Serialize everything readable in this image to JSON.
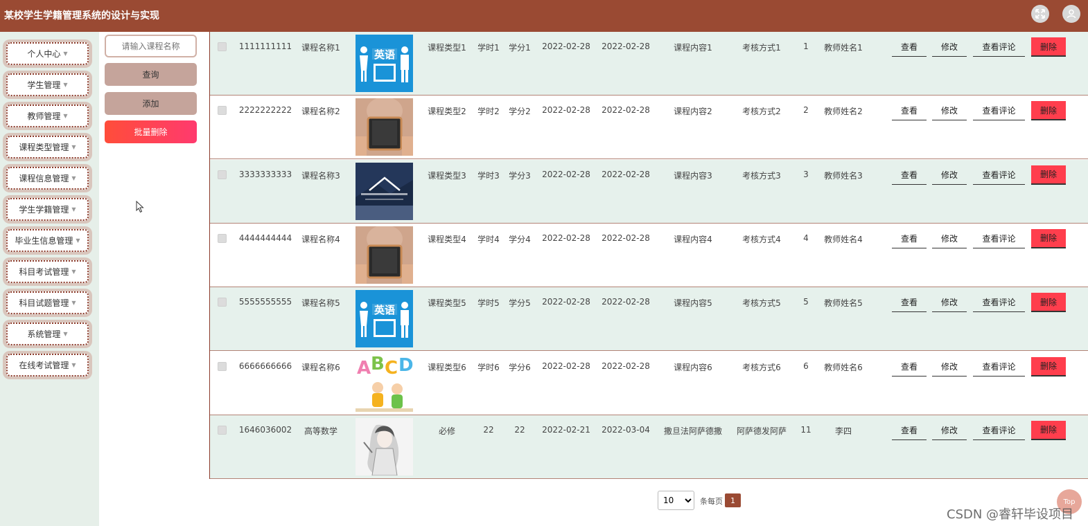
{
  "app": {
    "title": "某校学生学籍管理系统的设计与实现"
  },
  "header_icons": [
    "fullscreen-icon",
    "user-icon"
  ],
  "sidebar": {
    "items": [
      {
        "label": "个人中心"
      },
      {
        "label": "学生管理"
      },
      {
        "label": "教师管理"
      },
      {
        "label": "课程类型管理"
      },
      {
        "label": "课程信息管理"
      },
      {
        "label": "学生学籍管理"
      },
      {
        "label": "毕业生信息管理"
      },
      {
        "label": "科目考试管理"
      },
      {
        "label": "科目试题管理"
      },
      {
        "label": "系统管理"
      },
      {
        "label": "在线考试管理"
      }
    ]
  },
  "actions": {
    "search_placeholder": "请输入课程名称",
    "query_label": "查询",
    "add_label": "添加",
    "batch_delete_label": "批量删除"
  },
  "row_actions": {
    "view": "查看",
    "edit": "修改",
    "comments": "查看评论",
    "delete": "删除"
  },
  "rows": [
    {
      "id": "1111111111",
      "name": "课程名称1",
      "image": "english-speaking-image",
      "type": "课程类型1",
      "hours": "学时1",
      "credits": "学分1",
      "start": "2022-02-28",
      "end": "2022-02-28",
      "content": "课程内容1",
      "exam": "考核方式1",
      "num": "1",
      "teacher": "教师姓名1"
    },
    {
      "id": "2222222222",
      "name": "课程名称2",
      "image": "do-you-speak-english-image",
      "type": "课程类型2",
      "hours": "学时2",
      "credits": "学分2",
      "start": "2022-02-28",
      "end": "2022-02-28",
      "content": "课程内容2",
      "exam": "考核方式2",
      "num": "2",
      "teacher": "教师姓名2"
    },
    {
      "id": "3333333333",
      "name": "课程名称3",
      "image": "business-class-image",
      "type": "课程类型3",
      "hours": "学时3",
      "credits": "学分3",
      "start": "2022-02-28",
      "end": "2022-02-28",
      "content": "课程内容3",
      "exam": "考核方式3",
      "num": "3",
      "teacher": "教师姓名3"
    },
    {
      "id": "4444444444",
      "name": "课程名称4",
      "image": "do-you-speak-english-image",
      "type": "课程类型4",
      "hours": "学时4",
      "credits": "学分4",
      "start": "2022-02-28",
      "end": "2022-02-28",
      "content": "课程内容4",
      "exam": "考核方式4",
      "num": "4",
      "teacher": "教师姓名4"
    },
    {
      "id": "5555555555",
      "name": "课程名称5",
      "image": "english-speaking-image",
      "type": "课程类型5",
      "hours": "学时5",
      "credits": "学分5",
      "start": "2022-02-28",
      "end": "2022-02-28",
      "content": "课程内容5",
      "exam": "考核方式5",
      "num": "5",
      "teacher": "教师姓名5"
    },
    {
      "id": "6666666666",
      "name": "课程名称6",
      "image": "abcd-kids-image",
      "type": "课程类型6",
      "hours": "学时6",
      "credits": "学分6",
      "start": "2022-02-28",
      "end": "2022-02-28",
      "content": "课程内容6",
      "exam": "考核方式6",
      "num": "6",
      "teacher": "教师姓名6"
    },
    {
      "id": "1646036002",
      "name": "高等数学",
      "image": "anime-character-image",
      "type": "必修",
      "hours": "22",
      "credits": "22",
      "start": "2022-02-21",
      "end": "2022-03-04",
      "content": "撒旦法阿萨德撒",
      "exam": "阿萨德发阿萨",
      "num": "11",
      "teacher": "李四"
    }
  ],
  "pagination": {
    "page_size": "10",
    "per_page_label": "条每页",
    "current_page": "1"
  },
  "top_button_label": "Top",
  "watermark": "CSDN @睿轩毕设项目",
  "colors": {
    "header": "#9a4a33",
    "sidebar_bg": "#e6efe9",
    "row_alt": "#e6f1ec",
    "delete": "#ff3e4d"
  }
}
